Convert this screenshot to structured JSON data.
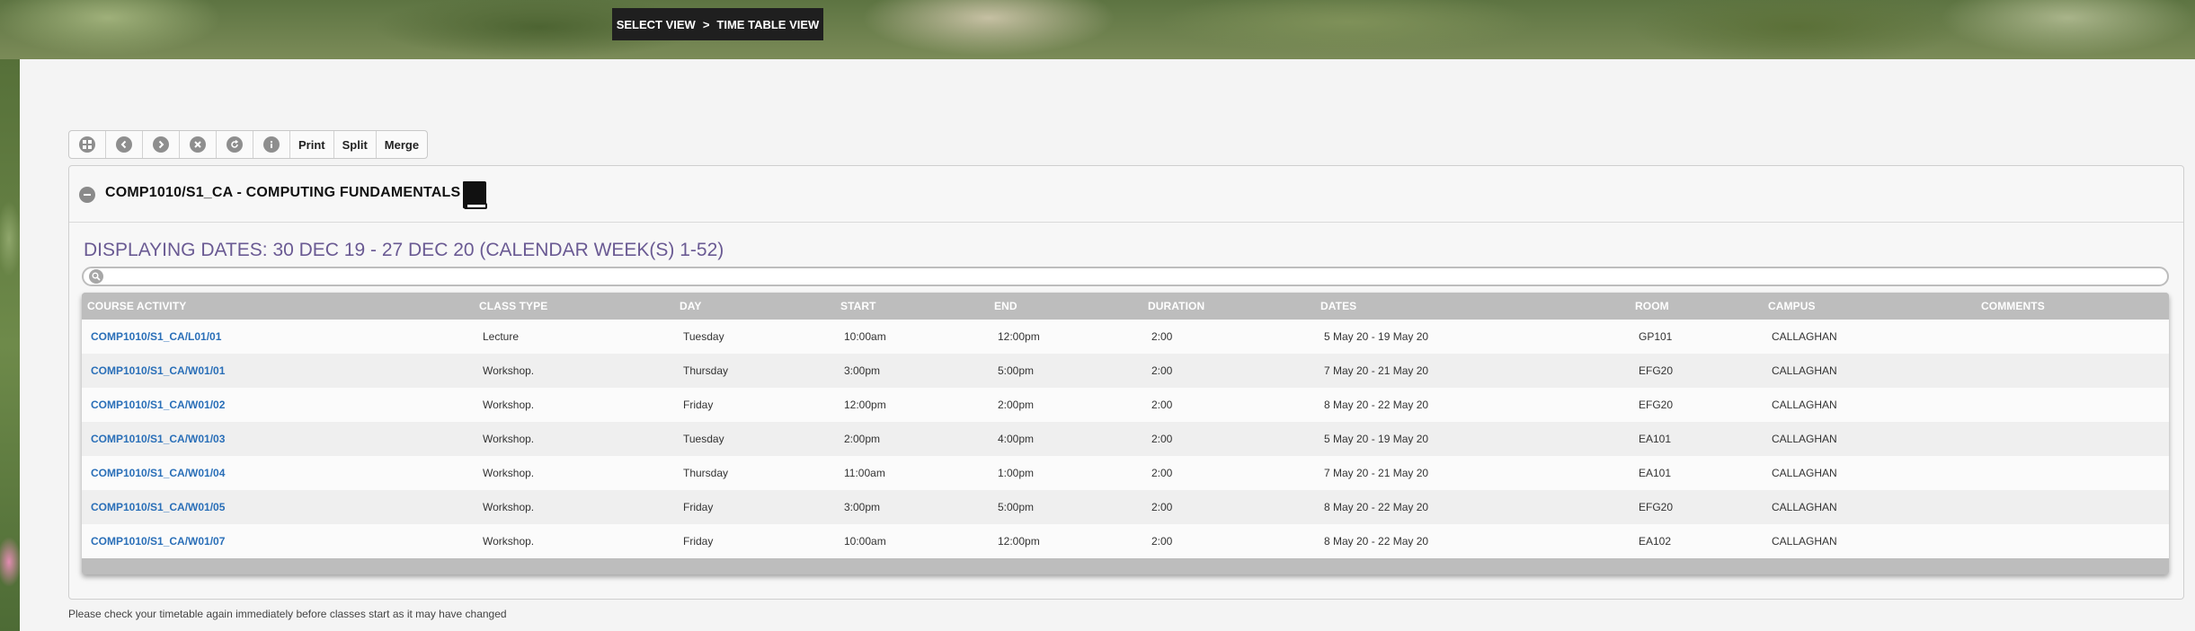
{
  "breadcrumb": {
    "first": "SELECT VIEW",
    "separator": ">",
    "second": "TIME TABLE VIEW"
  },
  "toolbar": {
    "icons": [
      "grid-icon",
      "previous-icon",
      "next-icon",
      "close-icon",
      "refresh-icon",
      "info-icon"
    ],
    "print_label": "Print",
    "split_label": "Split",
    "merge_label": "Merge"
  },
  "course": {
    "title": "COMP1010/S1_CA - COMPUTING FUNDAMENTALS",
    "displaying": "DISPLAYING DATES: 30 DEC 19 - 27 DEC 20 (CALENDAR WEEK(S) 1-52)"
  },
  "table": {
    "headers": [
      "COURSE ACTIVITY",
      "CLASS TYPE",
      "DAY",
      "START",
      "END",
      "DURATION",
      "DATES",
      "ROOM",
      "CAMPUS",
      "COMMENTS"
    ],
    "rows": [
      [
        "COMP1010/S1_CA/L01/01",
        "Lecture",
        "Tuesday",
        "10:00am",
        "12:00pm",
        "2:00",
        "5 May 20 - 19 May 20",
        "GP101",
        "CALLAGHAN",
        ""
      ],
      [
        "COMP1010/S1_CA/W01/01",
        "Workshop.",
        "Thursday",
        "3:00pm",
        "5:00pm",
        "2:00",
        "7 May 20 - 21 May 20",
        "EFG20",
        "CALLAGHAN",
        ""
      ],
      [
        "COMP1010/S1_CA/W01/02",
        "Workshop.",
        "Friday",
        "12:00pm",
        "2:00pm",
        "2:00",
        "8 May 20 - 22 May 20",
        "EFG20",
        "CALLAGHAN",
        ""
      ],
      [
        "COMP1010/S1_CA/W01/03",
        "Workshop.",
        "Tuesday",
        "2:00pm",
        "4:00pm",
        "2:00",
        "5 May 20 - 19 May 20",
        "EA101",
        "CALLAGHAN",
        ""
      ],
      [
        "COMP1010/S1_CA/W01/04",
        "Workshop.",
        "Thursday",
        "11:00am",
        "1:00pm",
        "2:00",
        "7 May 20 - 21 May 20",
        "EA101",
        "CALLAGHAN",
        ""
      ],
      [
        "COMP1010/S1_CA/W01/05",
        "Workshop.",
        "Friday",
        "3:00pm",
        "5:00pm",
        "2:00",
        "8 May 20 - 22 May 20",
        "EFG20",
        "CALLAGHAN",
        ""
      ],
      [
        "COMP1010/S1_CA/W01/07",
        "Workshop.",
        "Friday",
        "10:00am",
        "12:00pm",
        "2:00",
        "8 May 20 - 22 May 20",
        "EA102",
        "CALLAGHAN",
        ""
      ]
    ]
  },
  "footer_note": "Please check your timetable again immediately before classes start as it may have changed"
}
